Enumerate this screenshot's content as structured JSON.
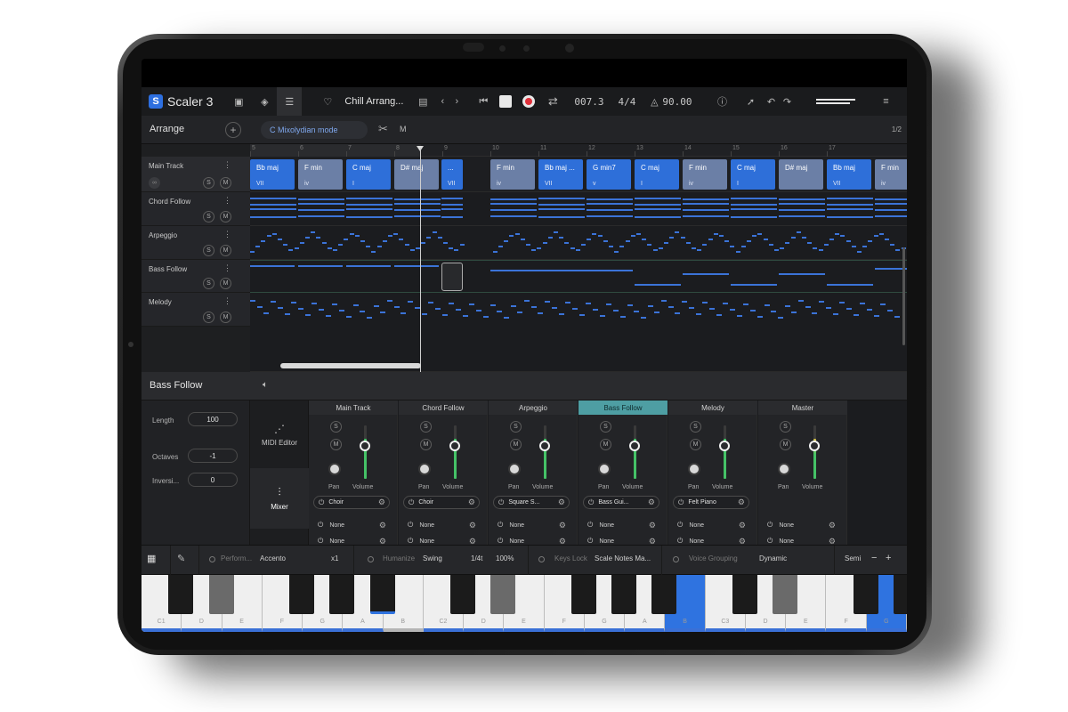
{
  "topbar": {
    "logo_letter": "S",
    "app_name": "Scaler 3",
    "project_name": "Chill Arrang...",
    "position": "007.3",
    "time_signature": "4/4",
    "tempo": "90.00"
  },
  "arrange": {
    "title": "Arrange",
    "add_label": "+",
    "scale_mode": "C Mixolydian mode",
    "m_label": "M",
    "page": "1/2",
    "ruler_numbers": [
      "5",
      "6",
      "7",
      "8",
      "9",
      "10",
      "11",
      "12",
      "13",
      "14",
      "15",
      "16",
      "17"
    ],
    "tracks": [
      {
        "name": "Main Track",
        "solo": "S",
        "mute": "M"
      },
      {
        "name": "Chord Follow",
        "solo": "S",
        "mute": "M"
      },
      {
        "name": "Arpeggio",
        "solo": "S",
        "mute": "M"
      },
      {
        "name": "Bass Follow",
        "solo": "S",
        "mute": "M"
      },
      {
        "name": "Melody",
        "solo": "S",
        "mute": "M"
      }
    ],
    "chords": [
      {
        "name": "Bb maj",
        "roman": "VII",
        "color": "#2e6fd9"
      },
      {
        "name": "F min",
        "roman": "iv",
        "color": "#6b7fa6"
      },
      {
        "name": "C maj",
        "roman": "I",
        "color": "#2e6fd9"
      },
      {
        "name": "D# maj",
        "roman": "",
        "color": "#6b7fa6"
      },
      {
        "name": "...",
        "roman": "VII",
        "color": "#2e6fd9"
      },
      {
        "name": "F min",
        "roman": "iv",
        "color": "#6b7fa6"
      },
      {
        "name": "Bb maj ...",
        "roman": "VII",
        "color": "#2e6fd9"
      },
      {
        "name": "G min7",
        "roman": "v",
        "color": "#2e6fd9"
      },
      {
        "name": "C maj",
        "roman": "I",
        "color": "#2e6fd9"
      },
      {
        "name": "F min",
        "roman": "iv",
        "color": "#6b7fa6"
      },
      {
        "name": "C maj",
        "roman": "I",
        "color": "#2e6fd9"
      },
      {
        "name": "D# maj",
        "roman": "",
        "color": "#6b7fa6"
      },
      {
        "name": "Bb maj",
        "roman": "VII",
        "color": "#2e6fd9"
      },
      {
        "name": "F min",
        "roman": "iv",
        "color": "#6b7fa6"
      }
    ]
  },
  "bass_follow": {
    "title": "Bass Follow",
    "params": [
      {
        "label": "Length",
        "value": "100"
      },
      {
        "label": "Octaves",
        "value": "-1"
      },
      {
        "label": "Inversi...",
        "value": "0"
      }
    ],
    "tabs": [
      {
        "label": "MIDI Editor"
      },
      {
        "label": "Mixer"
      }
    ]
  },
  "mixer": {
    "pan_label": "Pan",
    "volume_label": "Volume",
    "solo": "S",
    "mute": "M",
    "channels": [
      {
        "name": "Main Track",
        "instrument": "Choir",
        "slots": [
          "None",
          "None"
        ],
        "level": 0.75
      },
      {
        "name": "Chord Follow",
        "instrument": "Choir",
        "slots": [
          "None",
          "None"
        ],
        "level": 0.75
      },
      {
        "name": "Arpeggio",
        "instrument": "Square S...",
        "slots": [
          "None",
          "None"
        ],
        "level": 0.75
      },
      {
        "name": "Bass Follow",
        "instrument": "Bass Gui...",
        "slots": [
          "None",
          "None"
        ],
        "level": 0.75
      },
      {
        "name": "Melody",
        "instrument": "Felt Piano",
        "slots": [
          "None",
          "None"
        ],
        "level": 0.75
      },
      {
        "name": "Master",
        "instrument": "",
        "slots": [
          "None",
          "None"
        ],
        "level": 0.75
      }
    ]
  },
  "perform": {
    "perform_label": "Perform...",
    "perform_value": "Accento",
    "perform_mult": "x1",
    "humanize_label": "Humanize",
    "humanize_value": "Swing",
    "humanize_div": "1/4t",
    "humanize_pct": "100%",
    "keyslock_label": "Keys Lock",
    "keyslock_value": "Scale Notes Ma...",
    "voice_label": "Voice Grouping",
    "voice_value": "Dynamic",
    "semi_label": "Semi",
    "minus": "−",
    "plus": "+"
  },
  "keyboard": {
    "white_keys": [
      "C1",
      "D",
      "E",
      "F",
      "G",
      "A",
      "B",
      "C2",
      "D",
      "E",
      "F",
      "G",
      "A",
      "B",
      "C3",
      "D",
      "E",
      "F",
      "G"
    ]
  }
}
